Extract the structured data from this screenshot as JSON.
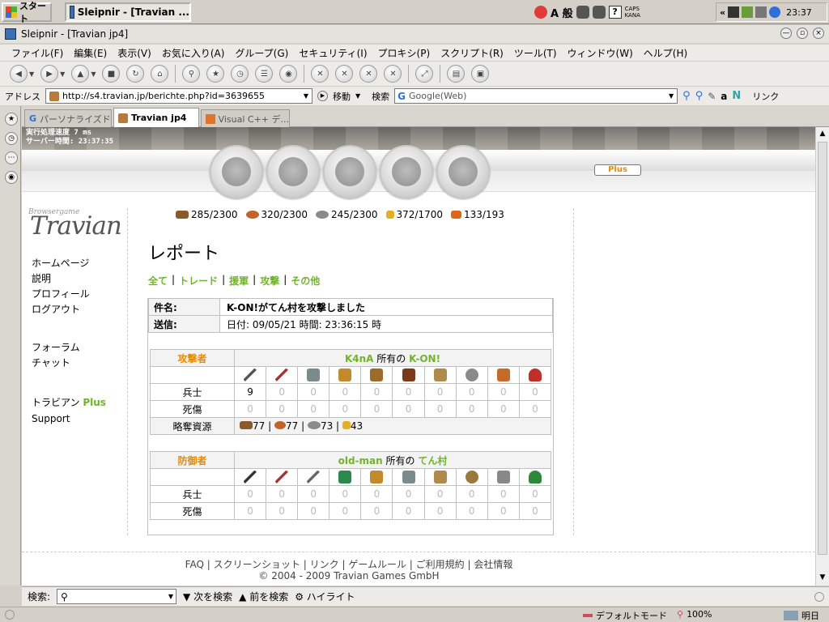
{
  "taskbar": {
    "start_label": "スタート",
    "task_title": "Sleipnir - [Travian ...",
    "caps": "CAPS",
    "kana": "KANA",
    "clock": "23:37"
  },
  "window": {
    "title": "Sleipnir - [Travian jp4]"
  },
  "menu": [
    "ファイル(F)",
    "編集(E)",
    "表示(V)",
    "お気に入り(A)",
    "グループ(G)",
    "セキュリティ(I)",
    "プロキシ(P)",
    "スクリプト(R)",
    "ツール(T)",
    "ウィンドウ(W)",
    "ヘルプ(H)"
  ],
  "address": {
    "label": "アドレス",
    "url": "http://s4.travian.jp/berichte.php?id=3639655",
    "go_label": "移動",
    "search_label": "検索",
    "search_placeholder": "Google(Web)",
    "links_label": "リンク"
  },
  "tabs": [
    {
      "label": "パーソナライズド..."
    },
    {
      "label": "Travian jp4"
    },
    {
      "label": "Visual C++ デ..."
    }
  ],
  "game": {
    "exec_speed": "実行処理速度 7 ms",
    "server_time": "サーバー時間: 23:37:35",
    "plus_label": "Plus",
    "logo_sub": "Browsergame",
    "logo_main": "Travian",
    "left_menu": {
      "home": "ホームページ",
      "manual": "説明",
      "profile": "プロフィール",
      "logout": "ログアウト",
      "forum": "フォーラム",
      "chat": "チャット",
      "travian_plus_a": "トラビアン",
      "travian_plus_b": "Plus",
      "support": "Support"
    },
    "resources": {
      "wood": "285/2300",
      "clay": "320/2300",
      "iron": "245/2300",
      "crop": "372/1700",
      "consumption": "133/193"
    }
  },
  "report": {
    "title": "レポート",
    "filters": [
      "全て",
      "トレード",
      "援軍",
      "攻撃",
      "その他"
    ],
    "subject_label": "件名:",
    "subject_value": "K-ON!がてん村を攻撃しました",
    "sent_label": "送信:",
    "sent_value": "日付: 09/05/21 時間: 23:36:15 時",
    "attacker": {
      "label": "攻撃者",
      "player": "K4nA",
      "owned_by": "所有の",
      "village": "K-ON!",
      "troops_label": "兵士",
      "troops": [
        "9",
        "0",
        "0",
        "0",
        "0",
        "0",
        "0",
        "0",
        "0",
        "0"
      ],
      "casualties_label": "死傷",
      "casualties": [
        "0",
        "0",
        "0",
        "0",
        "0",
        "0",
        "0",
        "0",
        "0",
        "0"
      ],
      "bounty_label": "略奪資源",
      "bounty": [
        "77",
        "77",
        "73",
        "43"
      ]
    },
    "defender": {
      "label": "防御者",
      "player": "old-man",
      "owned_by": "所有の",
      "village": "てん村",
      "troops_label": "兵士",
      "troops": [
        "0",
        "0",
        "0",
        "0",
        "0",
        "0",
        "0",
        "0",
        "0",
        "0"
      ],
      "casualties_label": "死傷",
      "casualties": [
        "0",
        "0",
        "0",
        "0",
        "0",
        "0",
        "0",
        "0",
        "0",
        "0"
      ]
    }
  },
  "footer": {
    "faq": "FAQ",
    "screenshots": "スクリーンショット",
    "links": "リンク",
    "rules": "ゲームルール",
    "terms": "ご利用規約",
    "company": "会社情報",
    "copyright": "© 2004 - 2009 Travian Games GmbH"
  },
  "findbar": {
    "label": "検索:",
    "next": "次を検索",
    "prev": "前を検索",
    "highlight": "ハイライト"
  },
  "status": {
    "mode": "デフォルトモード",
    "zoom": "100%",
    "weather": "明日"
  },
  "colors": {
    "travian_green": "#71b42b",
    "travian_orange": "#e98b00"
  }
}
